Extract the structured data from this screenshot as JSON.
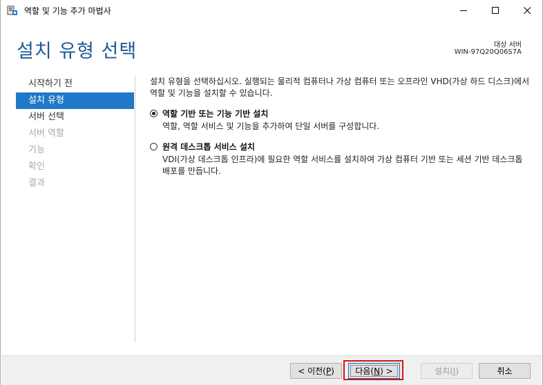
{
  "window": {
    "title": "역할 및 기능 추가 마법사",
    "minimize_glyph": "—",
    "maximize_glyph": "☐",
    "close_glyph": "✕"
  },
  "header": {
    "title": "설치 유형 선택",
    "target_label": "대상 서버",
    "target_server": "WIN-97Q20Q06S7A"
  },
  "nav": {
    "items": [
      {
        "label": "시작하기 전",
        "state": "enabled"
      },
      {
        "label": "설치 유형",
        "state": "active"
      },
      {
        "label": "서버 선택",
        "state": "enabled"
      },
      {
        "label": "서버 역할",
        "state": "disabled"
      },
      {
        "label": "기능",
        "state": "disabled"
      },
      {
        "label": "확인",
        "state": "disabled"
      },
      {
        "label": "결과",
        "state": "disabled"
      }
    ]
  },
  "content": {
    "intro": "설치 유형을 선택하십시오. 실행되는 물리적 컴퓨터나 가상 컴퓨터 또는 오프라인 VHD(가상 하드 디스크)에서 역할 및 기능을 설치할 수 있습니다.",
    "options": [
      {
        "title": "역할 기반 또는 기능 기반 설치",
        "description": "역할, 역할 서비스 및 기능을 추가하여 단일 서버를 구성합니다.",
        "selected": true
      },
      {
        "title": "원격 데스크톱 서비스 설치",
        "description": "VDI(가상 데스크톱 인프라)에 필요한 역할 서비스를 설치하여 가상 컴퓨터 기반 또는 세션 기반 데스크톱 배포를 만듭니다.",
        "selected": false
      }
    ]
  },
  "buttons": {
    "prev_text": "< 이전(",
    "prev_key": "P",
    "prev_tail": ")",
    "next_text": "다음(",
    "next_key": "N",
    "next_tail": ") >",
    "install_text": "설치(",
    "install_key": "I",
    "install_tail": ")",
    "cancel": "취소"
  },
  "colors": {
    "accent": "#1f78c8",
    "title": "#1e5a96",
    "highlight": "#e01010"
  }
}
